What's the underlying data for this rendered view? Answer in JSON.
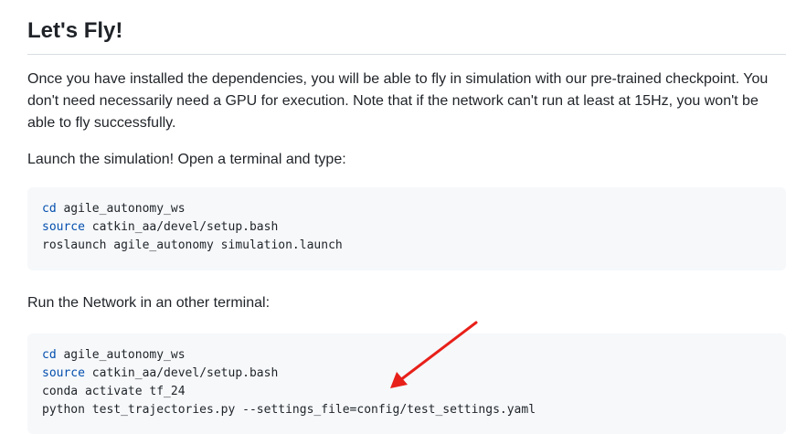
{
  "heading": "Let's Fly!",
  "paragraph1": "Once you have installed the dependencies, you will be able to fly in simulation with our pre-trained checkpoint. You don't need necessarily need a GPU for execution. Note that if the network can't run at least at 15Hz, you won't be able to fly successfully.",
  "paragraph2": "Launch the simulation! Open a terminal and type:",
  "code_block1": {
    "line1_kw": "cd",
    "line1_rest": " agile_autonomy_ws",
    "line2_kw": "source",
    "line2_rest": " catkin_aa/devel/setup.bash",
    "line3": "roslaunch agile_autonomy simulation.launch"
  },
  "paragraph3": "Run the Network in an other terminal:",
  "code_block2": {
    "line1_kw": "cd",
    "line1_rest": " agile_autonomy_ws",
    "line2_kw": "source",
    "line2_rest": " catkin_aa/devel/setup.bash",
    "line3": "conda activate tf_24",
    "line4": "python test_trajectories.py --settings_file=config/test_settings.yaml"
  },
  "colors": {
    "keyword": "#0550ae",
    "code_background": "#f6f8fa",
    "annotation_arrow": "#e8201a"
  }
}
